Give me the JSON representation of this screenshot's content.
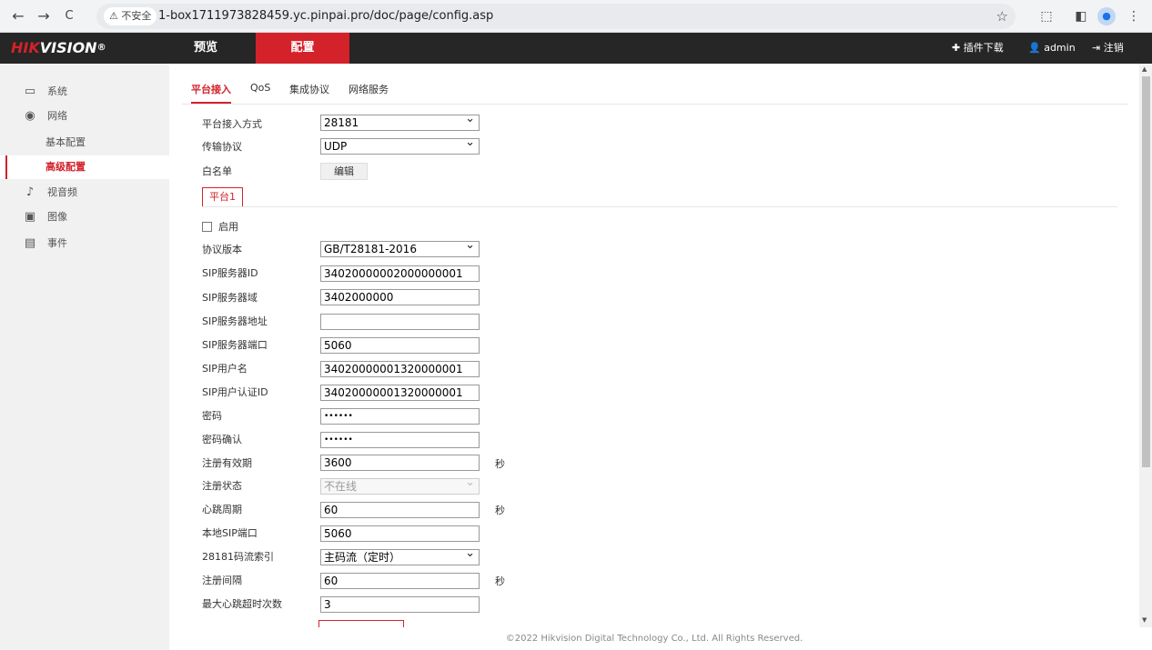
{
  "browser": {
    "back": "←",
    "forward": "→",
    "reload": "C",
    "security_label": "⚠ 不安全",
    "url": "1-box1711973828459.yc.pinpai.pro/doc/page/config.asp"
  },
  "topnav": {
    "logo_red": "HIK",
    "logo_white": "VISION",
    "logo_mark": "®",
    "tabs": [
      {
        "label": "预览"
      },
      {
        "label": "配置"
      }
    ],
    "plugin_label": "插件下载",
    "user_label": "admin",
    "logout_label": "注销"
  },
  "sidebar": {
    "items": [
      {
        "label": "系统",
        "icon": "monitor-icon"
      },
      {
        "label": "网络",
        "icon": "globe-icon"
      },
      {
        "label": "基本配置"
      },
      {
        "label": "高级配置"
      },
      {
        "label": "视音频",
        "icon": "audio-video-icon"
      },
      {
        "label": "图像",
        "icon": "image-icon"
      },
      {
        "label": "事件",
        "icon": "calendar-icon"
      }
    ]
  },
  "tabs": [
    {
      "label": "平台接入"
    },
    {
      "label": "QoS"
    },
    {
      "label": "集成协议"
    },
    {
      "label": "网络服务"
    }
  ],
  "form": {
    "access_method": {
      "label": "平台接入方式",
      "value": "28181"
    },
    "transport": {
      "label": "传输协议",
      "value": "UDP"
    },
    "whitelist": {
      "label": "白名单",
      "button": "编辑"
    },
    "platform_tab": "平台1",
    "enable_label": "启用",
    "protocol_version": {
      "label": "协议版本",
      "value": "GB/T28181-2016"
    },
    "sip_server_id": {
      "label": "SIP服务器ID",
      "value": "34020000002000000001"
    },
    "sip_server_domain": {
      "label": "SIP服务器域",
      "value": "3402000000"
    },
    "sip_server_address": {
      "label": "SIP服务器地址",
      "value": ""
    },
    "sip_server_port": {
      "label": "SIP服务器端口",
      "value": "5060"
    },
    "sip_username": {
      "label": "SIP用户名",
      "value": "34020000001320000001"
    },
    "sip_auth_id": {
      "label": "SIP用户认证ID",
      "value": "34020000001320000001"
    },
    "password": {
      "label": "密码",
      "value": "••••••"
    },
    "password_confirm": {
      "label": "密码确认",
      "value": "••••••"
    },
    "register_validity": {
      "label": "注册有效期",
      "value": "3600",
      "unit": "秒"
    },
    "register_status": {
      "label": "注册状态",
      "value": "不在线"
    },
    "heartbeat_period": {
      "label": "心跳周期",
      "value": "60",
      "unit": "秒"
    },
    "local_sip_port": {
      "label": "本地SIP端口",
      "value": "5060"
    },
    "stream_index": {
      "label": "28181码流索引",
      "value": "主码流（定时）"
    },
    "register_interval": {
      "label": "注册间隔",
      "value": "60",
      "unit": "秒"
    },
    "max_heartbeat_timeout": {
      "label": "最大心跳超时次数",
      "value": "3"
    }
  },
  "footer": "©2022 Hikvision Digital Technology Co., Ltd. All Rights Reserved.",
  "colors": {
    "accent": "#d3222a",
    "topbar": "#262626",
    "sidebar": "#f1f1f1"
  }
}
